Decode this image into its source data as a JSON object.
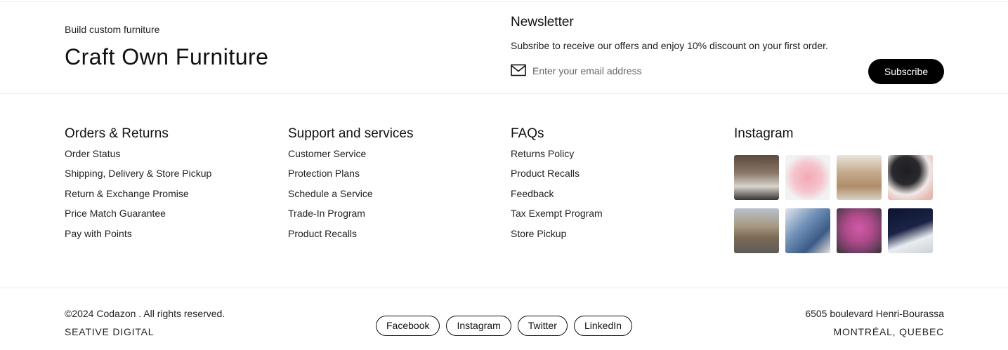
{
  "brand": {
    "tagline": "Build custom furniture",
    "title": "Craft Own Furniture"
  },
  "newsletter": {
    "title": "Newsletter",
    "description": "Subsribe to receive our offers and enjoy 10% discount on your first order.",
    "email_placeholder": "Enter your email address",
    "email_value": "",
    "subscribe_label": "Subscribe",
    "icon": "mail-icon"
  },
  "columns": [
    {
      "title": "Orders & Returns",
      "links": [
        "Order Status",
        "Shipping, Delivery & Store Pickup",
        "Return & Exchange Promise",
        "Price Match Guarantee",
        "Pay with Points"
      ]
    },
    {
      "title": "Support and services",
      "links": [
        "Customer Service",
        "Protection Plans",
        "Schedule a Service",
        "Trade-In Program",
        "Product Recalls"
      ]
    },
    {
      "title": "FAQs",
      "links": [
        "Returns Policy",
        "Product Recalls",
        "Feedback",
        "Tax Exempt Program",
        "Store Pickup"
      ]
    }
  ],
  "instagram": {
    "title": "Instagram",
    "photos": [
      "instagram-photo",
      "instagram-photo",
      "instagram-photo",
      "instagram-photo",
      "instagram-photo",
      "instagram-photo",
      "instagram-photo",
      "instagram-photo"
    ]
  },
  "footer": {
    "copyright": "©2024 Codazon . All rights reserved.",
    "company": "SEATIVE DIGITAL",
    "socials": [
      "Facebook",
      "Instagram",
      "Twitter",
      "LinkedIn"
    ],
    "address_line1": "6505 boulevard Henri-Bourassa",
    "address_line2": "MONTRÉAL, QUEBEC"
  },
  "colors": {
    "accent": "#000000",
    "text": "#222222",
    "divider": "#ececec"
  }
}
